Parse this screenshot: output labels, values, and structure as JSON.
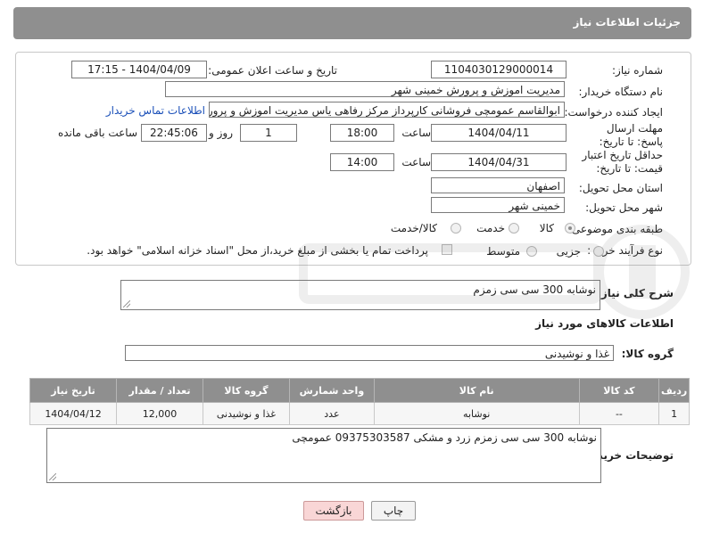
{
  "header": {
    "title": "جزئیات اطلاعات نیاز"
  },
  "fields": {
    "need_number_label": "شماره نیاز:",
    "need_number": "1104030129000014",
    "announce_label": "تاریخ و ساعت اعلان عمومی:",
    "announce_value": "1404/04/09 - 17:15",
    "buyer_org_label": "نام دستگاه خریدار:",
    "buyer_org": "مدیریت اموزش و پرورش خمینی شهر",
    "creator_label": "ایجاد کننده درخواست:",
    "creator": "ابوالقاسم عمومچی فروشانی کارپرداز مرکز رفاهی یاس مدیریت اموزش و پرورش خمینی شهر",
    "contact_link": "اطلاعات تماس خریدار",
    "reply_deadline_label": "مهلت ارسال پاسخ: تا تاریخ:",
    "reply_date": "1404/04/11",
    "time_label": "ساعت",
    "reply_time": "18:00",
    "days_value": "1",
    "days_label": "روز و",
    "remaining_time": "22:45:06",
    "remaining_label": "ساعت باقی مانده",
    "price_deadline_label": "حداقل تاریخ اعتبار قیمت: تا تاریخ:",
    "price_date": "1404/04/31",
    "price_time": "14:00",
    "province_label": "استان محل تحویل:",
    "province": "اصفهان",
    "city_label": "شهر محل تحویل:",
    "city": "خمینی شهر",
    "category_label": "طبقه بندی موضوعی:",
    "cat_goods": "کالا",
    "cat_service": "خدمت",
    "cat_both": "کالا/خدمت",
    "process_label": "نوع فرآیند خرید :",
    "proc_partial": "جزیی",
    "proc_medium": "متوسط",
    "payment_note": "پرداخت تمام یا بخشی از مبلغ خرید،از محل \"اسناد خزانه اسلامی\" خواهد بود."
  },
  "description": {
    "label": "شرح کلی نیاز:",
    "value": "نوشابه 300 سی سی زمزم"
  },
  "goods_section": {
    "title": "اطلاعات کالاهای مورد نیاز",
    "group_label": "گروه کالا:",
    "group_value": "غذا و نوشیدنی"
  },
  "table": {
    "headers": [
      "ردیف",
      "کد کالا",
      "نام کالا",
      "واحد شمارش",
      "گروه کالا",
      "تعداد / مقدار",
      "تاریخ نیاز"
    ],
    "rows": [
      [
        "1",
        "--",
        "نوشابه",
        "عدد",
        "غذا و نوشیدنی",
        "12,000",
        "1404/04/12"
      ]
    ]
  },
  "buyer_notes": {
    "label": "توضیحات خریدار:",
    "value": "نوشابه 300 سی سی زمزم زرد و مشکی   09375303587  عمومچی"
  },
  "buttons": {
    "print": "چاپ",
    "back": "بازگشت"
  },
  "colors": {
    "header_bg": "#8f8f8f",
    "link": "#1a4fb8",
    "back_button_bg": "#f9d6d6"
  }
}
